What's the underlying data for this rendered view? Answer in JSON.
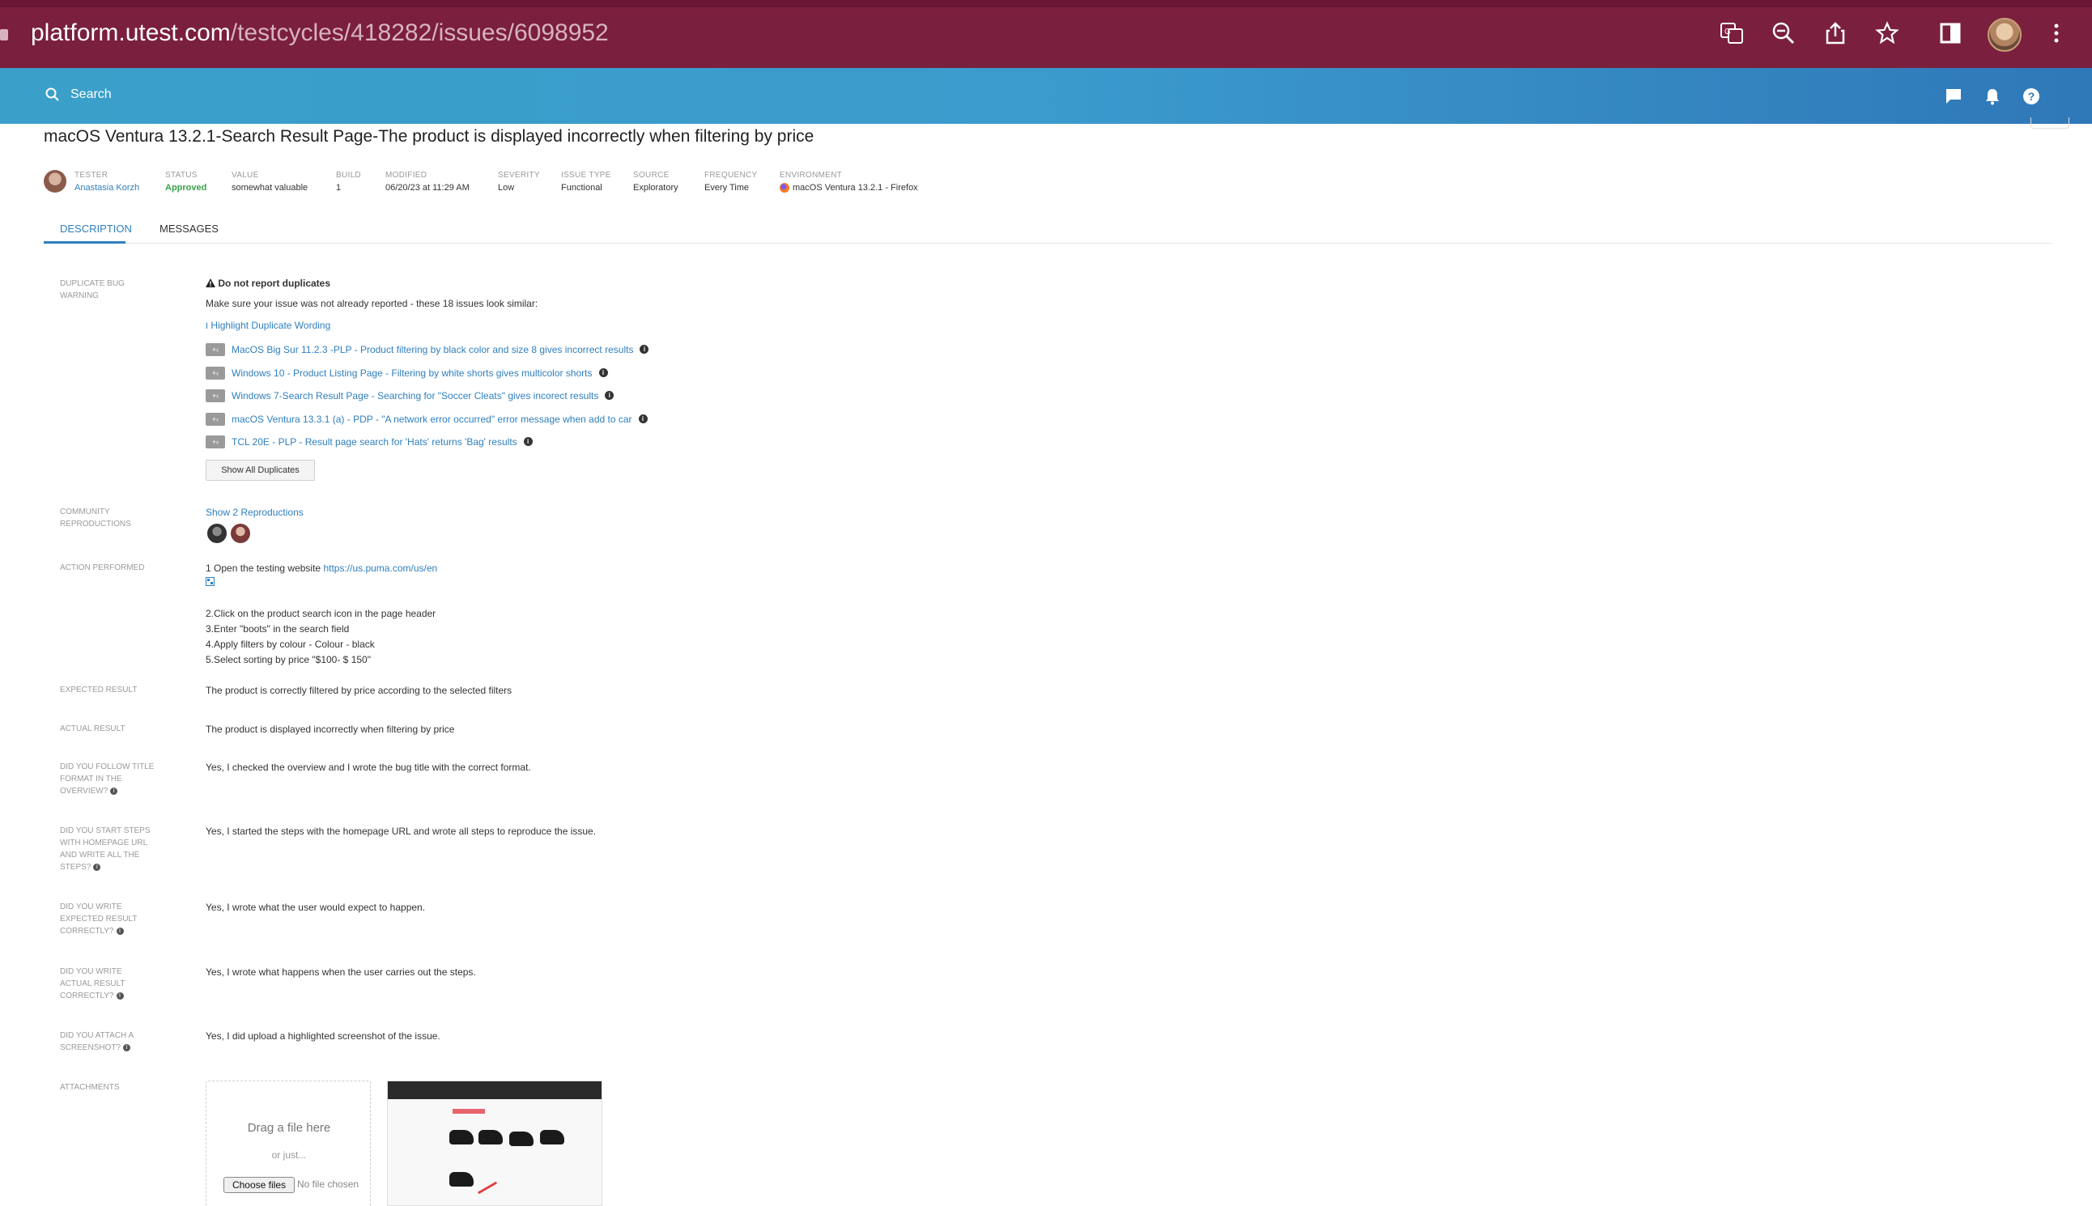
{
  "browser": {
    "url_host": "platform.utest.com",
    "url_path": "/testcycles/418282/issues/6098952"
  },
  "header": {
    "search_placeholder": "Search"
  },
  "issue": {
    "title": "macOS Ventura 13.2.1-Search Result Page-The product is displayed incorrectly when filtering by price",
    "meta": {
      "tester": {
        "label": "TESTER",
        "value": "Anastasia Korzh"
      },
      "status": {
        "label": "STATUS",
        "value": "Approved"
      },
      "value": {
        "label": "VALUE",
        "value": "somewhat valuable"
      },
      "build": {
        "label": "BUILD",
        "value": "1"
      },
      "modified": {
        "label": "MODIFIED",
        "value": "06/20/23 at 11:29 AM"
      },
      "severity": {
        "label": "SEVERITY",
        "value": "Low"
      },
      "issue_type": {
        "label": "ISSUE TYPE",
        "value": "Functional"
      },
      "source": {
        "label": "SOURCE",
        "value": "Exploratory"
      },
      "frequency": {
        "label": "FREQUENCY",
        "value": "Every Time"
      },
      "environment": {
        "label": "ENVIRONMENT",
        "value": "macOS Ventura 13.2.1 - Firefox"
      }
    }
  },
  "tabs": {
    "description": "DESCRIPTION",
    "messages": "MESSAGES"
  },
  "duplicate": {
    "label": "DUPLICATE BUG WARNING",
    "heading": "Do not report duplicates",
    "text": "Make sure your issue was not already reported - these 18 issues look similar:",
    "highlight": "Highlight Duplicate Wording",
    "items": [
      "MacOS Big Sur 11.2.3 -PLP - Product filtering by black color and size 8 gives incorrect results",
      "Windows 10 - Product Listing Page - Filtering by white shorts gives multicolor shorts",
      "Windows 7-Search Result Page - Searching for \"Soccer Cleats\" gives incorect results",
      "macOS Ventura 13.3.1 (a) - PDP - \"A network error occurred\" error message when add to car",
      "TCL 20E - PLP - Result page search for 'Hats' returns 'Bag' results"
    ],
    "show_all": "Show All Duplicates"
  },
  "community": {
    "label": "COMMUNITY REPRODUCTIONS",
    "link": "Show 2 Reproductions"
  },
  "action": {
    "label": "ACTION PERFORMED",
    "step1": "1 Open the testing website ",
    "step1_link": "https://us.puma.com/us/en",
    "step2": "2.Click on the product search icon in the page header",
    "step3": "3.Enter \"boots\" in the search field",
    "step4": "4.Apply filters by colour - Colour - black",
    "step5": "5.Select sorting by price \"$100- $ 150\""
  },
  "expected": {
    "label": "EXPECTED RESULT",
    "value": "The product is correctly filtered by price according to the selected filters"
  },
  "actual": {
    "label": "ACTUAL RESULT",
    "value": "The product is displayed incorrectly when filtering by price"
  },
  "q_title": {
    "label": "DID YOU FOLLOW TITLE FORMAT IN THE OVERVIEW?",
    "value": "Yes, I checked the overview and I wrote the bug title with the correct format."
  },
  "q_steps": {
    "label": "DID YOU START STEPS WITH HOMEPAGE URL AND WRITE ALL THE STEPS?",
    "value": "Yes, I started the steps with the homepage URL and wrote all steps to reproduce the issue."
  },
  "q_expected": {
    "label": "DID YOU WRITE EXPECTED RESULT CORRECTLY?",
    "value": "Yes, I wrote what the user would expect to happen."
  },
  "q_actual": {
    "label": "DID YOU WRITE ACTUAL RESULT CORRECTLY?",
    "value": "Yes, I wrote what happens when the user carries out the steps."
  },
  "q_screenshot": {
    "label": "DID YOU ATTACH A SCREENSHOT?",
    "value": "Yes, I did upload a highlighted screenshot of the issue."
  },
  "attachments": {
    "label": "ATTACHMENTS",
    "drag": "Drag a file here",
    "or": "or just...",
    "choose": "Choose files",
    "no_file": "No file chosen"
  },
  "colors": {
    "browser_bar": "#7a1f3d",
    "app_header": "#3aa0c9",
    "link": "#2f7fbf",
    "approved": "#3aa24a"
  },
  "icons": [
    "translate-icon",
    "zoom-out-icon",
    "share-icon",
    "bookmark-star-icon",
    "sidebar-icon",
    "menu-dots-icon",
    "search-icon",
    "chat-icon",
    "bell-icon",
    "help-icon",
    "warning-icon",
    "info-icon",
    "firefox-icon"
  ]
}
